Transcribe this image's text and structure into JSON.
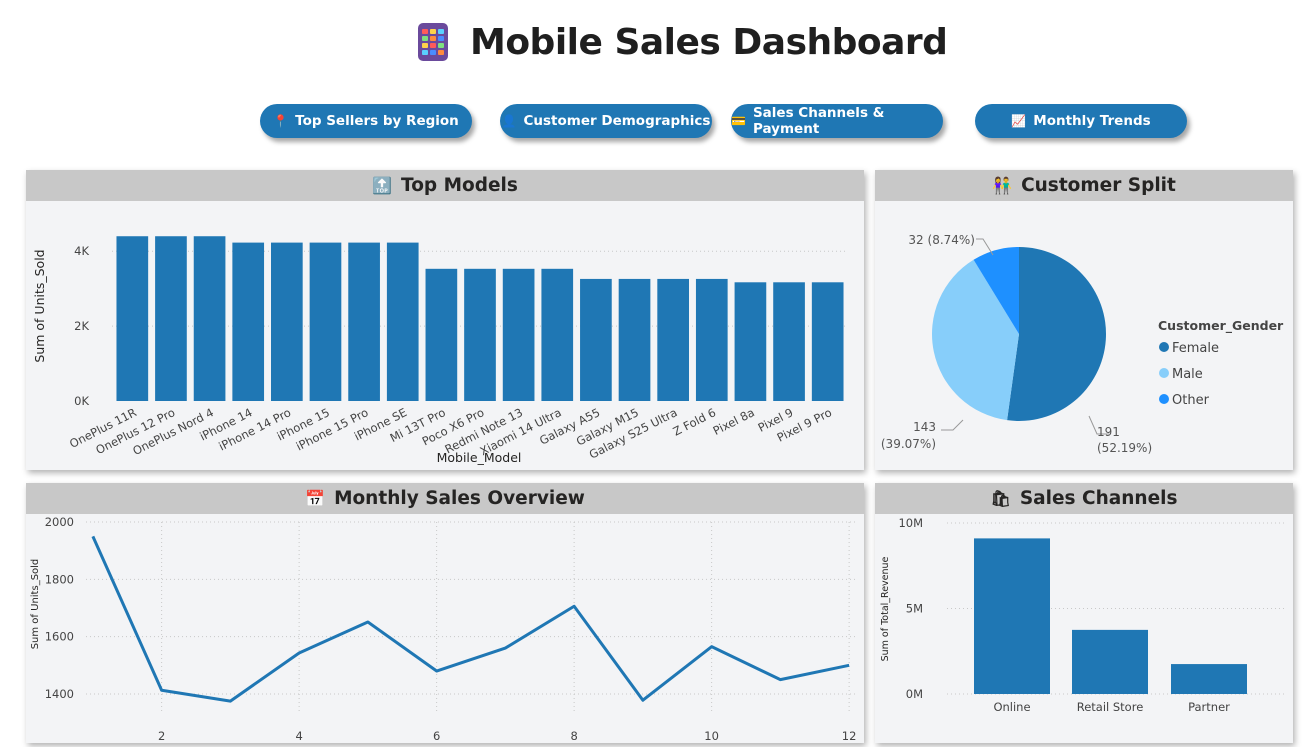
{
  "header": {
    "title": "Mobile Sales Dashboard",
    "icon": "mobile-phone-icon"
  },
  "nav": [
    {
      "label": "Top Sellers by Region",
      "icon": "pin-icon",
      "glyph": "📍"
    },
    {
      "label": "Customer Demographics",
      "icon": "person-icon",
      "glyph": "👤"
    },
    {
      "label": "Sales Channels & Payment",
      "icon": "card-icon",
      "glyph": "💳"
    },
    {
      "label": "Monthly Trends",
      "icon": "trend-chart-icon",
      "glyph": "📈"
    }
  ],
  "panels": {
    "top_models": {
      "title": "Top Models",
      "icon": "top-arrow-icon",
      "glyph": "🔝"
    },
    "customer_split": {
      "title": "Customer Split",
      "icon": "people-icon",
      "glyph": "👫"
    },
    "monthly": {
      "title": "Monthly Sales Overview",
      "icon": "calendar-icon",
      "glyph": "📅"
    },
    "channels": {
      "title": "Sales Channels",
      "icon": "shopping-bag-icon",
      "glyph": "🛍"
    }
  },
  "colors": {
    "bar": "#1f77b4",
    "header_bg": "#c8c8c8",
    "panel_bg": "#f3f4f6",
    "female": "#1f77b4",
    "male": "#87cefa",
    "other": "#1e90ff"
  },
  "chart_data": [
    {
      "type": "bar",
      "title": "Top Models",
      "xlabel": "Mobile_Model",
      "ylabel": "Sum of Units_Sold",
      "ylim": [
        0,
        4700
      ],
      "yticks": [
        0,
        2000,
        4000
      ],
      "ytick_labels": [
        "0K",
        "2K",
        "4K"
      ],
      "categories": [
        "OnePlus 11R",
        "OnePlus 12 Pro",
        "OnePlus Nord 4",
        "iPhone 14",
        "iPhone 14 Pro",
        "iPhone 15",
        "iPhone 15 Pro",
        "iPhone SE",
        "Mi 13T Pro",
        "Poco X6 Pro",
        "Redmi Note 13",
        "Xiaomi 14 Ultra",
        "Galaxy A55",
        "Galaxy M15",
        "Galaxy S25 Ultra",
        "Z Fold 6",
        "Pixel 8a",
        "Pixel 9",
        "Pixel 9 Pro"
      ],
      "values": [
        4400,
        4400,
        4400,
        4230,
        4230,
        4230,
        4230,
        4230,
        3530,
        3530,
        3530,
        3530,
        3260,
        3260,
        3260,
        3260,
        3170,
        3170,
        3170
      ],
      "grid": true
    },
    {
      "type": "pie",
      "title": "Customer Split",
      "legend_title": "Customer_Gender",
      "legend_position": "right",
      "slices": [
        {
          "label": "Female",
          "value": 191,
          "pct": "52.19%",
          "color": "#1f77b4"
        },
        {
          "label": "Male",
          "value": 143,
          "pct": "39.07%",
          "color": "#87cefa"
        },
        {
          "label": "Other",
          "value": 32,
          "pct": "8.74%",
          "color": "#1e90ff"
        }
      ],
      "data_labels": [
        "191",
        "(52.19%)",
        "143",
        "(39.07%)",
        "32 (8.74%)"
      ]
    },
    {
      "type": "line",
      "title": "Monthly Sales Overview",
      "xlabel": "MonthNum",
      "ylabel": "Sum of Units_Sold",
      "x": [
        1,
        2,
        3,
        4,
        5,
        6,
        7,
        8,
        9,
        10,
        11,
        12
      ],
      "y": [
        1950,
        1413,
        1375,
        1543,
        1651,
        1480,
        1560,
        1706,
        1378,
        1565,
        1450,
        1500
      ],
      "xlim": [
        0.9,
        12.1
      ],
      "ylim": [
        1330,
        2000
      ],
      "xticks": [
        2,
        4,
        6,
        8,
        10,
        12
      ],
      "yticks": [
        1400,
        1600,
        1800,
        2000
      ],
      "grid": true
    },
    {
      "type": "bar",
      "title": "Sales Channels",
      "xlabel": "Sales_Channel",
      "ylabel": "Sum of Total_Revenue",
      "categories": [
        "Online",
        "Retail Store",
        "Partner"
      ],
      "values": [
        9100000,
        3750000,
        1750000
      ],
      "ylim": [
        0,
        10000000
      ],
      "yticks": [
        0,
        5000000,
        10000000
      ],
      "ytick_labels": [
        "0M",
        "5M",
        "10M"
      ],
      "grid": true
    }
  ]
}
